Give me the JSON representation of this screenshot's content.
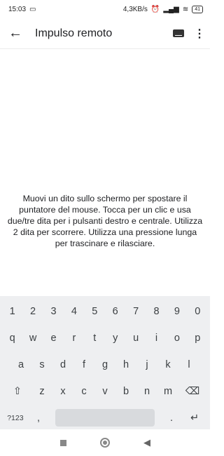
{
  "status_bar": {
    "time": "15:03",
    "network_speed": "4,3KB/s",
    "battery": "41"
  },
  "app_bar": {
    "title": "Impulso remoto"
  },
  "touchpad": {
    "instructions": "Muovi un dito sullo schermo per spostare il puntatore del mouse. Tocca per un clic e usa due/tre dita per i pulsanti destro e centrale. Utilizza 2 dita per scorrere. Utilizza una pressione lunga per trascinare e rilasciare."
  },
  "keyboard": {
    "row_numbers": [
      "1",
      "2",
      "3",
      "4",
      "5",
      "6",
      "7",
      "8",
      "9",
      "0"
    ],
    "row_q": [
      "q",
      "w",
      "e",
      "r",
      "t",
      "y",
      "u",
      "i",
      "o",
      "p"
    ],
    "row_a": [
      "a",
      "s",
      "d",
      "f",
      "g",
      "h",
      "j",
      "k",
      "l"
    ],
    "row_z": [
      "z",
      "x",
      "c",
      "v",
      "b",
      "n",
      "m"
    ],
    "symbols_label": "?123",
    "comma": ",",
    "period": "."
  }
}
